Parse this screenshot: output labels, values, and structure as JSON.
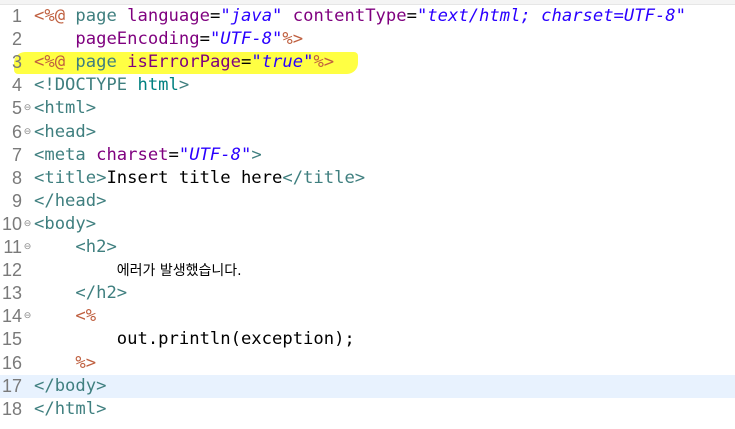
{
  "lines": [
    {
      "n": "1",
      "fold": "",
      "parts": [
        {
          "c": "jsp",
          "t": "<%@ "
        },
        {
          "c": "kw",
          "t": "page "
        },
        {
          "c": "attr",
          "t": "language"
        },
        {
          "c": "eq",
          "t": "="
        },
        {
          "c": "str",
          "t": "\"java\""
        },
        {
          "c": "txt",
          "t": " "
        },
        {
          "c": "attr",
          "t": "contentType"
        },
        {
          "c": "eq",
          "t": "="
        },
        {
          "c": "str",
          "t": "\"text/html; charset=UTF-8\""
        }
      ]
    },
    {
      "n": "2",
      "fold": "",
      "parts": [
        {
          "c": "txt",
          "t": "    "
        },
        {
          "c": "attr",
          "t": "pageEncoding"
        },
        {
          "c": "eq",
          "t": "="
        },
        {
          "c": "str",
          "t": "\"UTF-8\""
        },
        {
          "c": "jsp",
          "t": "%>"
        }
      ]
    },
    {
      "n": "3",
      "fold": "",
      "parts": [
        {
          "c": "jsp",
          "t": "<%@ "
        },
        {
          "c": "kw",
          "t": "page "
        },
        {
          "c": "attr",
          "t": "isErrorPage"
        },
        {
          "c": "eq",
          "t": "="
        },
        {
          "c": "str",
          "t": "\"true\""
        },
        {
          "c": "jsp",
          "t": "%>"
        }
      ]
    },
    {
      "n": "4",
      "fold": "",
      "parts": [
        {
          "c": "doctype",
          "t": "<!DOCTYPE "
        },
        {
          "c": "doctype-kw",
          "t": "html"
        },
        {
          "c": "doctype",
          "t": ">"
        }
      ]
    },
    {
      "n": "5",
      "fold": "⊖",
      "parts": [
        {
          "c": "tag",
          "t": "<html>"
        }
      ]
    },
    {
      "n": "6",
      "fold": "⊖",
      "parts": [
        {
          "c": "tag",
          "t": "<head>"
        }
      ]
    },
    {
      "n": "7",
      "fold": "",
      "parts": [
        {
          "c": "tag",
          "t": "<meta "
        },
        {
          "c": "attr",
          "t": "charset"
        },
        {
          "c": "eq",
          "t": "="
        },
        {
          "c": "str",
          "t": "\"UTF-8\""
        },
        {
          "c": "tag",
          "t": ">"
        }
      ]
    },
    {
      "n": "8",
      "fold": "",
      "parts": [
        {
          "c": "tag",
          "t": "<title>"
        },
        {
          "c": "txt",
          "t": "Insert title here"
        },
        {
          "c": "tag",
          "t": "</title>"
        }
      ]
    },
    {
      "n": "9",
      "fold": "",
      "parts": [
        {
          "c": "tag",
          "t": "</head>"
        }
      ]
    },
    {
      "n": "10",
      "fold": "⊖",
      "parts": [
        {
          "c": "tag",
          "t": "<body>"
        }
      ]
    },
    {
      "n": "11",
      "fold": "⊖",
      "parts": [
        {
          "c": "txt",
          "t": "    "
        },
        {
          "c": "tag",
          "t": "<h2>"
        }
      ]
    },
    {
      "n": "12",
      "fold": "",
      "parts": [
        {
          "c": "txt",
          "t": "        "
        },
        {
          "c": "korean",
          "t": "에러가 발생했습니다."
        }
      ]
    },
    {
      "n": "13",
      "fold": "",
      "parts": [
        {
          "c": "txt",
          "t": "    "
        },
        {
          "c": "tag",
          "t": "</h2>"
        }
      ]
    },
    {
      "n": "14",
      "fold": "⊖",
      "parts": [
        {
          "c": "txt",
          "t": "    "
        },
        {
          "c": "jsp",
          "t": "<%"
        }
      ]
    },
    {
      "n": "15",
      "fold": "",
      "parts": [
        {
          "c": "txt",
          "t": "        out.println(exception);"
        }
      ]
    },
    {
      "n": "16",
      "fold": "",
      "parts": [
        {
          "c": "txt",
          "t": "    "
        },
        {
          "c": "jsp",
          "t": "%>"
        }
      ]
    },
    {
      "n": "17",
      "fold": "",
      "current": true,
      "parts": [
        {
          "c": "tag",
          "t": "</body>"
        }
      ]
    },
    {
      "n": "18",
      "fold": "",
      "parts": [
        {
          "c": "tag",
          "t": "</html>"
        }
      ]
    }
  ],
  "colors": {
    "tag": "#3f7f7f",
    "jsp_delimiter": "#bf5f3f",
    "attribute": "#7f007f",
    "string": "#2a00ff",
    "line_number": "#7a7a7a",
    "current_line": "#e8f2fe",
    "highlighter": "#ffff33"
  }
}
